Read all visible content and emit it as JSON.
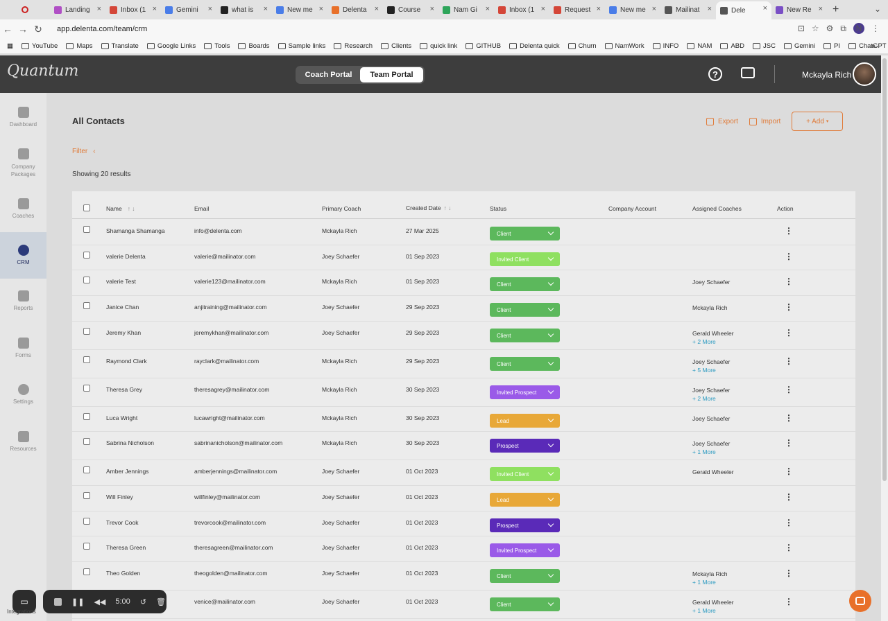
{
  "browser": {
    "tabs": [
      {
        "title": "Landing",
        "color": "#b04fc5"
      },
      {
        "title": "Inbox (1",
        "color": "#d44638"
      },
      {
        "title": "Gemini",
        "color": "#4a7de8"
      },
      {
        "title": "what is",
        "color": "#222222"
      },
      {
        "title": "New me",
        "color": "#4a7de8"
      },
      {
        "title": "Delenta",
        "color": "#e8702a"
      },
      {
        "title": "Course",
        "color": "#222222"
      },
      {
        "title": "Nam Gi",
        "color": "#2ea55a"
      },
      {
        "title": "Inbox (1",
        "color": "#d44638"
      },
      {
        "title": "Request",
        "color": "#d44638"
      },
      {
        "title": "New me",
        "color": "#4a7de8"
      },
      {
        "title": "Mailinat",
        "color": "#555555"
      },
      {
        "title": "Dele",
        "color": "#555555",
        "active": true
      },
      {
        "title": "New Re",
        "color": "#7a4fc5"
      }
    ],
    "url": "app.delenta.com/team/crm",
    "bookmarks": [
      "YouTube",
      "Maps",
      "Translate",
      "Google Links",
      "Tools",
      "Boards",
      "Sample links",
      "Research",
      "Clients",
      "quick link",
      "GITHUB",
      "Delenta quick",
      "Churn",
      "NamWork",
      "INFO",
      "NAM",
      "ABD",
      "JSC",
      "Gemini",
      "PI",
      "ChatGPT"
    ],
    "profile_initial": "N"
  },
  "header": {
    "logo": "Quantum",
    "portal_tabs": [
      "Coach Portal",
      "Team Portal"
    ],
    "help_glyph": "?",
    "user_name": "Mckayla Rich"
  },
  "sidebar": [
    {
      "label": "Dashboard"
    },
    {
      "label": "Company Packages"
    },
    {
      "label": "Coaches"
    },
    {
      "label": "CRM",
      "active": true
    },
    {
      "label": "Reports"
    },
    {
      "label": "Forms"
    },
    {
      "label": "Settings"
    },
    {
      "label": "Resources"
    },
    {
      "label": "Integrations"
    }
  ],
  "page": {
    "title": "All Contacts",
    "filter": "Filter",
    "results": "Showing 20 results",
    "export": "Export",
    "import": "Import",
    "add": "+ Add"
  },
  "table": {
    "columns": [
      "Name",
      "Email",
      "Primary Coach",
      "Created Date",
      "Status",
      "Company Account",
      "Assigned Coaches",
      "Action"
    ],
    "status_colors": {
      "Client": "#5cb85c",
      "Invited Client": "#8fe060",
      "Invited Prospect": "#9a5ae8",
      "Lead": "#e8a838",
      "Prospect": "#5a2ab8"
    },
    "rows": [
      {
        "name": "Shamanga Shamanga",
        "email": "info@delenta.com",
        "coach": "Mckayla Rich",
        "date": "27 Mar 2025",
        "status": "Client",
        "assigned": "",
        "more": ""
      },
      {
        "name": "valerie Delenta",
        "email": "valerie@mailinator.com",
        "coach": "Joey Schaefer",
        "date": "01 Sep 2023",
        "status": "Invited Client",
        "assigned": "",
        "more": ""
      },
      {
        "name": "valerie Test",
        "email": "valerie123@mailinator.com",
        "coach": "Mckayla Rich",
        "date": "01 Sep 2023",
        "status": "Client",
        "assigned": "Joey Schaefer",
        "more": ""
      },
      {
        "name": "Janice Chan",
        "email": "anjitraining@mailinator.com",
        "coach": "Joey Schaefer",
        "date": "29 Sep 2023",
        "status": "Client",
        "assigned": "Mckayla Rich",
        "more": ""
      },
      {
        "name": "Jeremy Khan",
        "email": "jeremykhan@mailinator.com",
        "coach": "Joey Schaefer",
        "date": "29 Sep 2023",
        "status": "Client",
        "assigned": "Gerald Wheeler",
        "more": "+ 2 More"
      },
      {
        "name": "Raymond Clark",
        "email": "rayclark@mailinator.com",
        "coach": "Mckayla Rich",
        "date": "29 Sep 2023",
        "status": "Client",
        "assigned": "Joey Schaefer",
        "more": "+ 5 More"
      },
      {
        "name": "Theresa Grey",
        "email": "theresagrey@mailinator.com",
        "coach": "Mckayla Rich",
        "date": "30 Sep 2023",
        "status": "Invited Prospect",
        "assigned": "Joey Schaefer",
        "more": "+ 2 More"
      },
      {
        "name": "Luca Wright",
        "email": "lucawright@mailinator.com",
        "coach": "Mckayla Rich",
        "date": "30 Sep 2023",
        "status": "Lead",
        "assigned": "Joey Schaefer",
        "more": ""
      },
      {
        "name": "Sabrina Nicholson",
        "email": "sabrinanicholson@mailinator.com",
        "coach": "Mckayla Rich",
        "date": "30 Sep 2023",
        "status": "Prospect",
        "assigned": "Joey Schaefer",
        "more": "+ 1 More"
      },
      {
        "name": "Amber Jennings",
        "email": "amberjennings@mailinator.com",
        "coach": "Joey Schaefer",
        "date": "01 Oct 2023",
        "status": "Invited Client",
        "assigned": "Gerald Wheeler",
        "more": ""
      },
      {
        "name": "Will Finley",
        "email": "willfinley@mailinator.com",
        "coach": "Joey Schaefer",
        "date": "01 Oct 2023",
        "status": "Lead",
        "assigned": "",
        "more": ""
      },
      {
        "name": "Trevor Cook",
        "email": "trevorcook@mailinator.com",
        "coach": "Joey Schaefer",
        "date": "01 Oct 2023",
        "status": "Prospect",
        "assigned": "",
        "more": ""
      },
      {
        "name": "Theresa Green",
        "email": "theresagreen@mailinator.com",
        "coach": "Joey Schaefer",
        "date": "01 Oct 2023",
        "status": "Invited Prospect",
        "assigned": "",
        "more": ""
      },
      {
        "name": "Theo Golden",
        "email": "theogolden@mailinator.com",
        "coach": "Joey Schaefer",
        "date": "01 Oct 2023",
        "status": "Client",
        "assigned": "Mckayla Rich",
        "more": "+ 1 More"
      },
      {
        "name": "",
        "email": "venice@mailinator.com",
        "coach": "Joey Schaefer",
        "date": "01 Oct 2023",
        "status": "Client",
        "assigned": "Gerald Wheeler",
        "more": "+ 1 More"
      }
    ]
  },
  "recorder": {
    "time": "5:00"
  }
}
